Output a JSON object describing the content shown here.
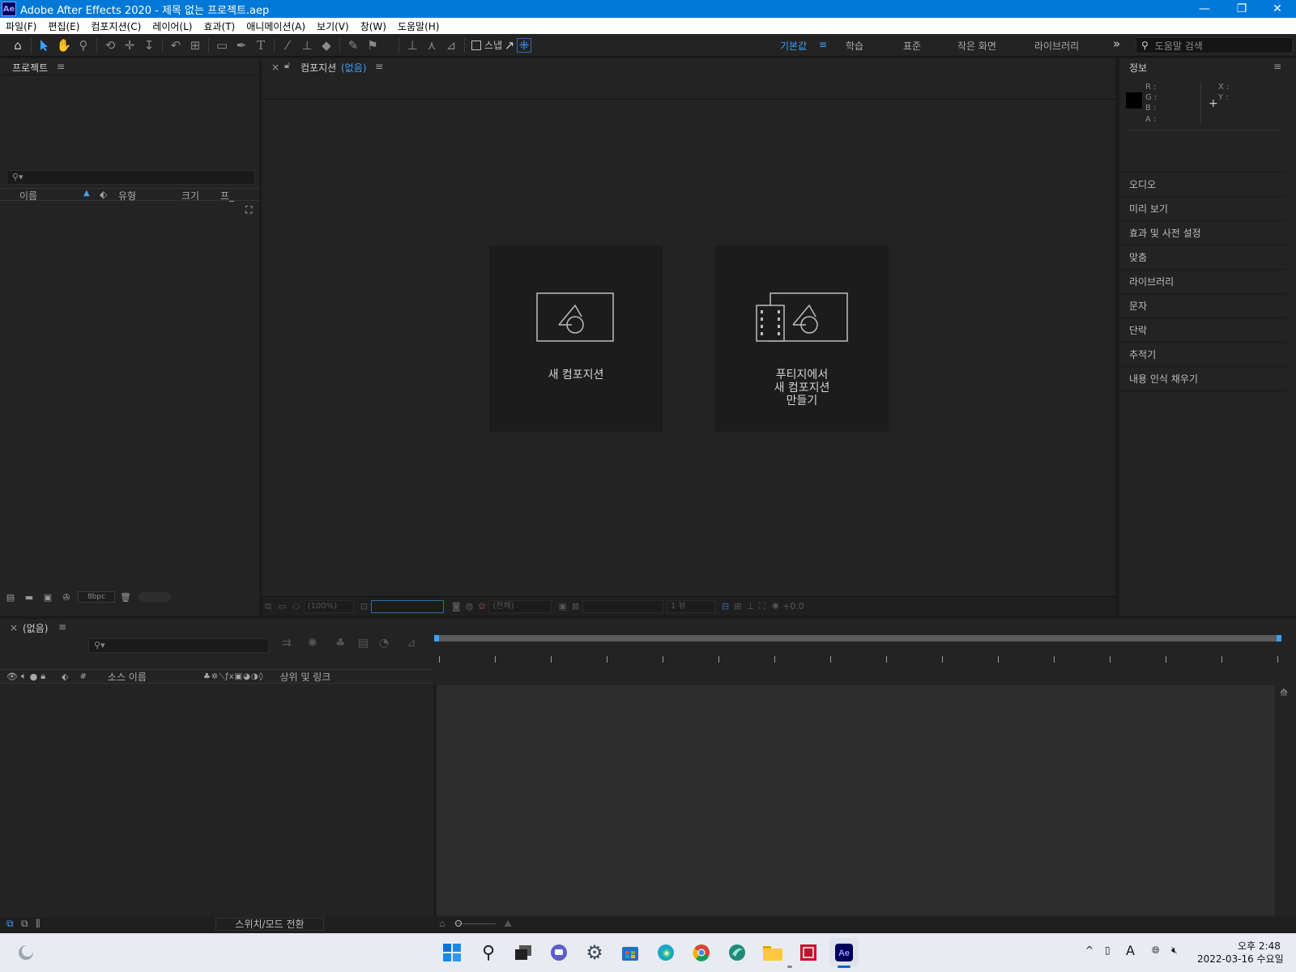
{
  "window": {
    "logo_text": "Ae",
    "title": "Adobe After Effects 2020 - 제목 없는 프로젝트.aep",
    "minimize": "—",
    "maximize": "❐",
    "close": "✕"
  },
  "menu": [
    "파일(F)",
    "편집(E)",
    "컴포지션(C)",
    "레이어(L)",
    "효과(T)",
    "애니메이션(A)",
    "보기(V)",
    "창(W)",
    "도움말(H)"
  ],
  "toolbar": {
    "snap_label": "스냅",
    "workspaces": [
      "기본값",
      "학습",
      "표준",
      "작은 화면",
      "라이브러리"
    ],
    "active_workspace": "기본값",
    "more": "»",
    "help_search_placeholder": "도움말 검색"
  },
  "project": {
    "title": "프로젝트",
    "menu": "≡",
    "columns": [
      "이름",
      "유형",
      "크기",
      "프_"
    ],
    "bpc": "8bpc"
  },
  "composition": {
    "close": "×",
    "title": "컴포지션",
    "status": "(없음)",
    "menu": "≡",
    "card_new": "새 컴포지션",
    "card_footage": [
      "푸티지에서",
      "새 컴포지션",
      "만들기"
    ],
    "footer": {
      "zoom": "(100%)",
      "resolution": "(전체)",
      "views": "1 뷰",
      "exposure": "+0.0"
    }
  },
  "info": {
    "title": "정보",
    "menu": "≡",
    "labels": [
      "R :",
      "G :",
      "B :",
      "A :"
    ],
    "coords": [
      "X :",
      "Y :"
    ],
    "crosshair": "+"
  },
  "right_panels": [
    "오디오",
    "미리 보기",
    "효과 및 사전 설정",
    "맞춤",
    "라이브러리",
    "문자",
    "단락",
    "추적기",
    "내용 인식 채우기"
  ],
  "timeline": {
    "close": "×",
    "title": "(없음)",
    "menu": "≡",
    "columns": {
      "hash": "#",
      "source_name": "소스 이름",
      "parent": "상위 및 링크"
    },
    "switch_mode": "스위치/모드 전환"
  },
  "taskbar": {
    "time": "오후 2:48",
    "date": "2022-03-16 수요일",
    "ime": "A",
    "tray_up": "^"
  },
  "colors": {
    "titlebar": "#0078d7",
    "accent": "#3aa0ff",
    "panel_bg": "#232323"
  }
}
